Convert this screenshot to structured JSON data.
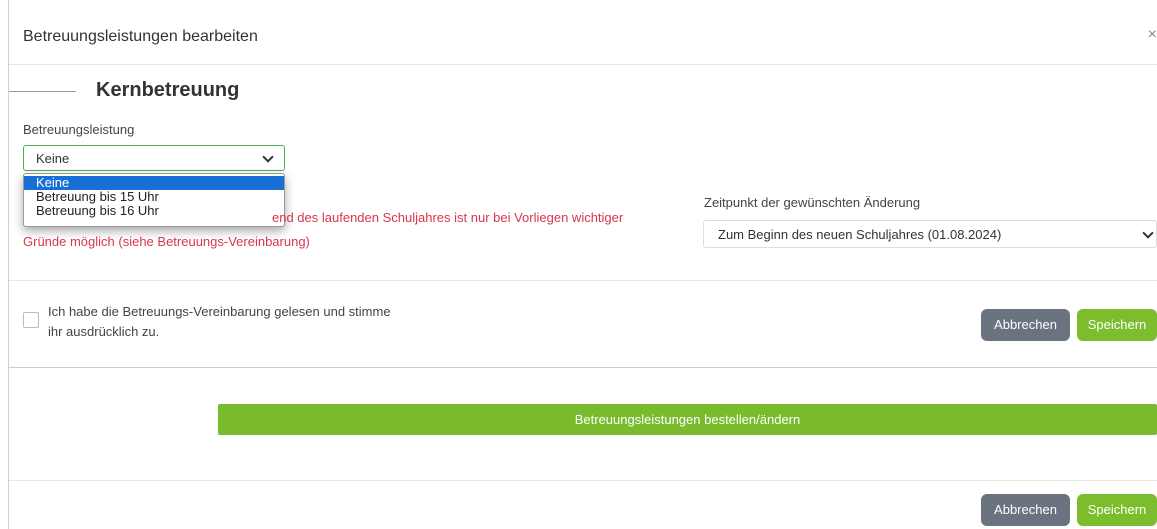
{
  "modal": {
    "title": "Betreuungsleistungen bearbeiten",
    "close": "×"
  },
  "section": {
    "legend": "Kernbetreuung"
  },
  "service_select": {
    "label": "Betreuungsleistung",
    "value": "Keine",
    "options": [
      "Keine",
      "Betreuung bis 15 Uhr",
      "Betreuung bis 16 Uhr"
    ]
  },
  "warning": {
    "line1_visible": "end des laufenden Schuljahres ist nur bei Vorliegen wichtiger",
    "line2": "Gründe möglich (siehe Betreuungs-Vereinbarung)"
  },
  "timing_select": {
    "label": "Zeitpunkt der gewünschten Änderung",
    "value": "Zum Beginn des neuen Schuljahres (01.08.2024)"
  },
  "agreement": {
    "checked": false,
    "line1": "Ich habe die Betreuungs-Vereinbarung gelesen und stimme",
    "line2": "ihr ausdrücklich zu."
  },
  "buttons": {
    "cancel": "Abbrechen",
    "save": "Speichern",
    "order": "Betreuungsleistungen bestellen/ändern"
  },
  "colors": {
    "green": "#7cbd2e",
    "gray": "#6b7280",
    "warning": "#d9364d",
    "selected": "#1a6fd6"
  }
}
